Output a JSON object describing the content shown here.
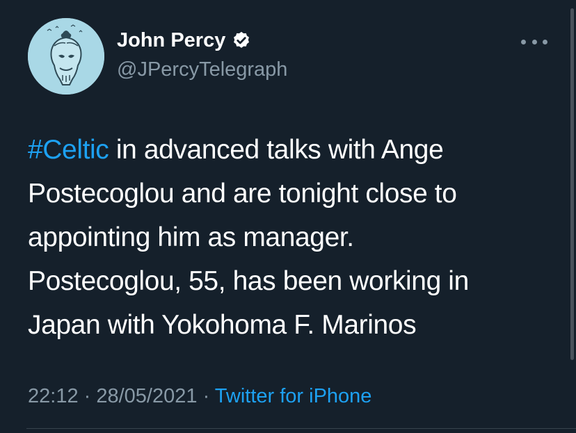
{
  "author": {
    "display_name": "John Percy",
    "handle": "@JPercyTelegraph",
    "verified": true,
    "avatar": "avatar-image"
  },
  "tweet": {
    "hashtag": "#Celtic",
    "line1_rest": " in advanced talks with Ange",
    "line2": "Postecoglou and are tonight close to",
    "line3": "appointing him as manager.",
    "line4": "Postecoglou, 55, has been working in",
    "line5": "Japan with Yokohoma F. Marinos"
  },
  "meta": {
    "time": "22:12",
    "separator": " · ",
    "date": "28/05/2021",
    "source": "Twitter for iPhone"
  },
  "icons": {
    "verified": "verified-badge-icon",
    "more": "more-options-icon"
  },
  "colors": {
    "background": "#15202b",
    "accent": "#1da1f2",
    "secondary_text": "#8899a6"
  }
}
